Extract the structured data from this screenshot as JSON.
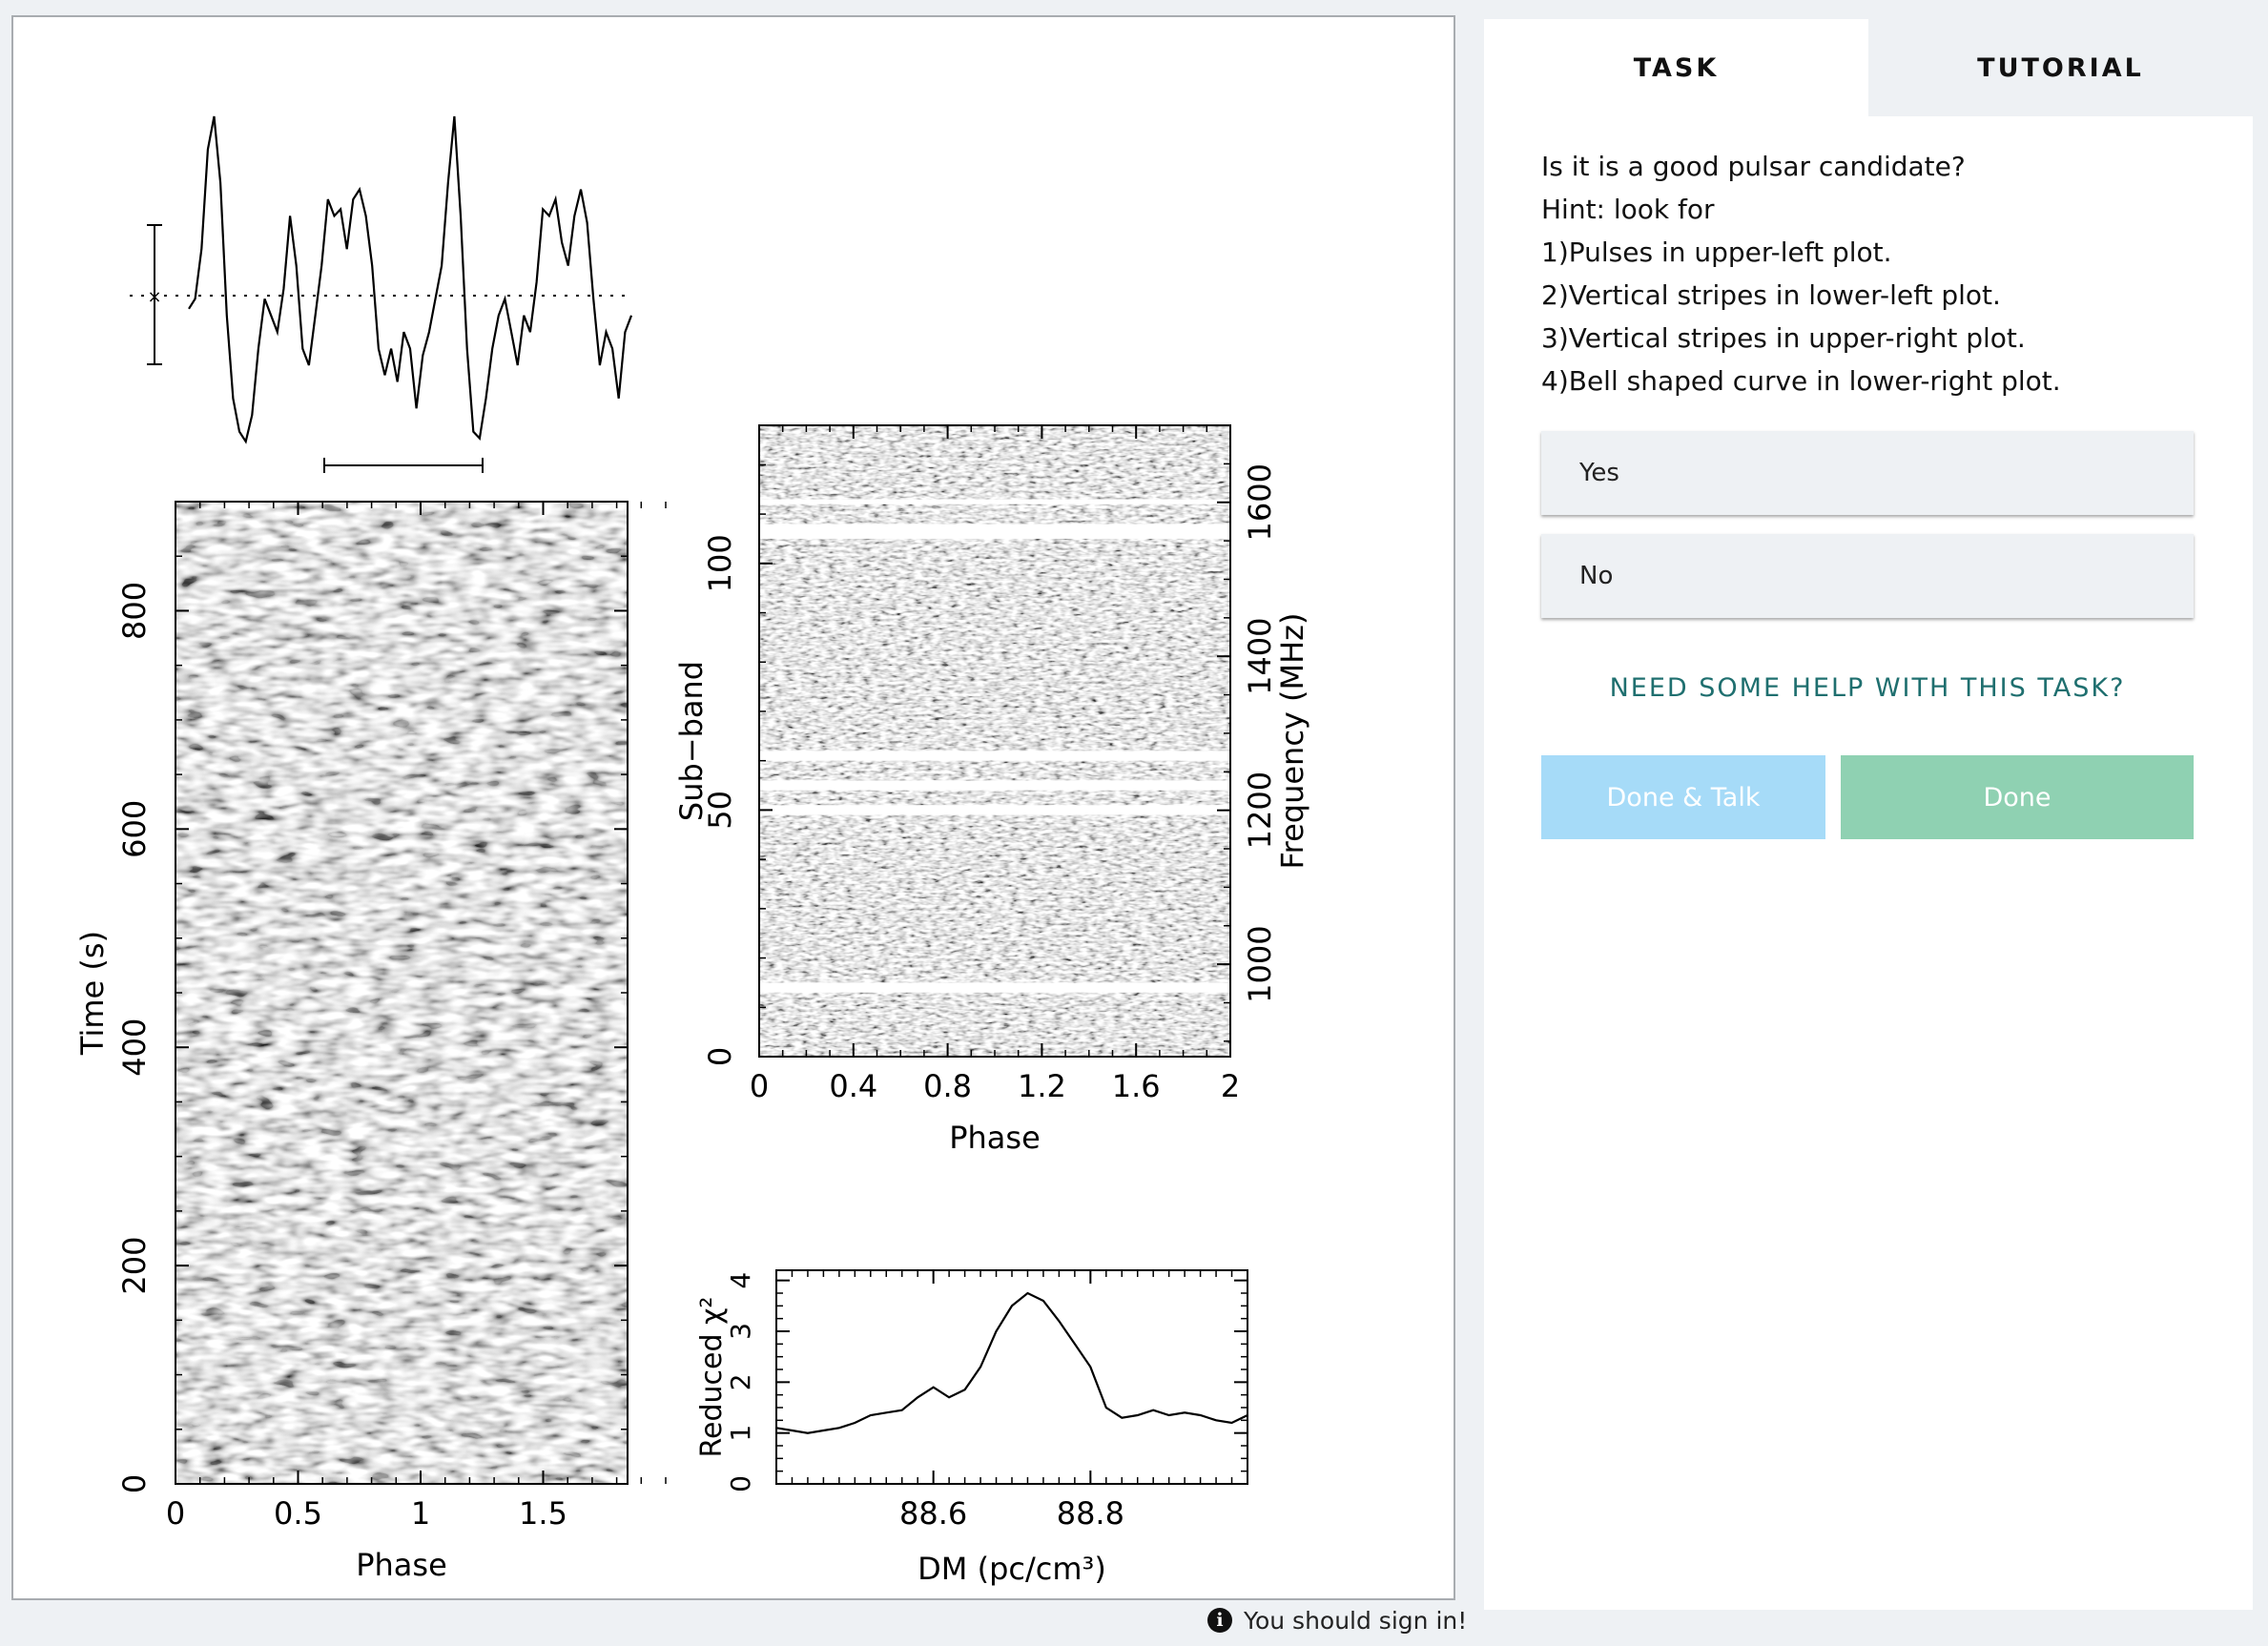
{
  "tabs": {
    "task": "TASK",
    "tutorial": "TUTORIAL"
  },
  "question": {
    "lines": [
      "Is it is a good pulsar candidate?",
      "Hint: look for",
      "1)Pulses in upper-left plot.",
      "2)Vertical stripes in lower-left plot.",
      "3)Vertical stripes in upper-right plot.",
      "4)Bell shaped curve in lower-right plot."
    ]
  },
  "answers": {
    "yes": "Yes",
    "no": "No"
  },
  "help_link": "NEED SOME HELP WITH THIS TASK?",
  "buttons": {
    "done_talk": "Done & Talk",
    "done": "Done"
  },
  "signin": "You should sign in!",
  "colors": {
    "done_talk": "#a6dbf8",
    "done": "#8fd1b2",
    "help_link": "#1f6f6f"
  },
  "chart_data": [
    {
      "type": "line",
      "name": "pulse-profile",
      "note_levels": "normalized intensity 0-1, two rotations",
      "y": [
        0.42,
        0.45,
        0.6,
        0.9,
        1.0,
        0.8,
        0.4,
        0.15,
        0.05,
        0.02,
        0.1,
        0.3,
        0.45,
        0.4,
        0.35,
        0.48,
        0.7,
        0.55,
        0.3,
        0.25,
        0.4,
        0.55,
        0.75,
        0.7,
        0.72,
        0.6,
        0.75,
        0.78,
        0.7,
        0.55,
        0.3,
        0.22,
        0.3,
        0.2,
        0.35,
        0.3,
        0.12,
        0.28,
        0.35,
        0.45,
        0.55,
        0.8,
        1.0,
        0.7,
        0.3,
        0.05,
        0.03,
        0.15,
        0.3,
        0.4,
        0.45,
        0.35,
        0.25,
        0.4,
        0.35,
        0.5,
        0.72,
        0.7,
        0.75,
        0.62,
        0.55,
        0.7,
        0.78,
        0.68,
        0.45,
        0.25,
        0.35,
        0.3,
        0.15,
        0.35,
        0.4
      ],
      "mean_level": 0.45,
      "errorbar_halfheight": 0.18
    },
    {
      "type": "heatmap",
      "name": "phase-time",
      "xlabel": "Phase",
      "ylabel": "Time (s)",
      "x_ticks": [
        "0",
        "0.5",
        "1",
        "1.5"
      ],
      "y_ticks": [
        "0",
        "200",
        "400",
        "600",
        "800"
      ],
      "xlim": [
        0,
        2
      ],
      "ylim": [
        0,
        900
      ]
    },
    {
      "type": "heatmap",
      "name": "phase-subband",
      "xlabel": "Phase",
      "ylabel": "Sub−band",
      "y2label": "Frequency (MHz)",
      "x_ticks": [
        "0",
        "0.4",
        "0.8",
        "1.2",
        "1.6",
        "2"
      ],
      "y_ticks": [
        "0",
        "50",
        "100"
      ],
      "y2_ticks": [
        "1000",
        "1200",
        "1400",
        "1600"
      ],
      "xlim": [
        0,
        2
      ],
      "ylim": [
        0,
        128
      ],
      "masked_subbands": [
        [
          13,
          15
        ],
        [
          49,
          51
        ],
        [
          54,
          56
        ],
        [
          60,
          62
        ],
        [
          105,
          108
        ],
        [
          112,
          113
        ]
      ]
    },
    {
      "type": "line",
      "name": "dm-chi2",
      "xlabel": "DM (pc/cm³)",
      "ylabel": "Reduced χ²",
      "x_ticks": [
        "88.6",
        "88.8"
      ],
      "y_ticks": [
        "0",
        "1",
        "2",
        "3",
        "4"
      ],
      "xlim": [
        88.4,
        89.0
      ],
      "ylim": [
        0,
        4.2
      ],
      "x": [
        88.4,
        88.42,
        88.44,
        88.46,
        88.48,
        88.5,
        88.52,
        88.54,
        88.56,
        88.58,
        88.6,
        88.62,
        88.64,
        88.66,
        88.68,
        88.7,
        88.72,
        88.74,
        88.76,
        88.78,
        88.8,
        88.82,
        88.84,
        88.86,
        88.88,
        88.9,
        88.92,
        88.94,
        88.96,
        88.98,
        89.0
      ],
      "y": [
        1.1,
        1.05,
        1.0,
        1.05,
        1.1,
        1.2,
        1.35,
        1.4,
        1.45,
        1.7,
        1.9,
        1.7,
        1.85,
        2.3,
        3.0,
        3.5,
        3.75,
        3.6,
        3.2,
        2.75,
        2.3,
        1.5,
        1.3,
        1.35,
        1.45,
        1.35,
        1.4,
        1.35,
        1.25,
        1.2,
        1.35
      ]
    }
  ]
}
